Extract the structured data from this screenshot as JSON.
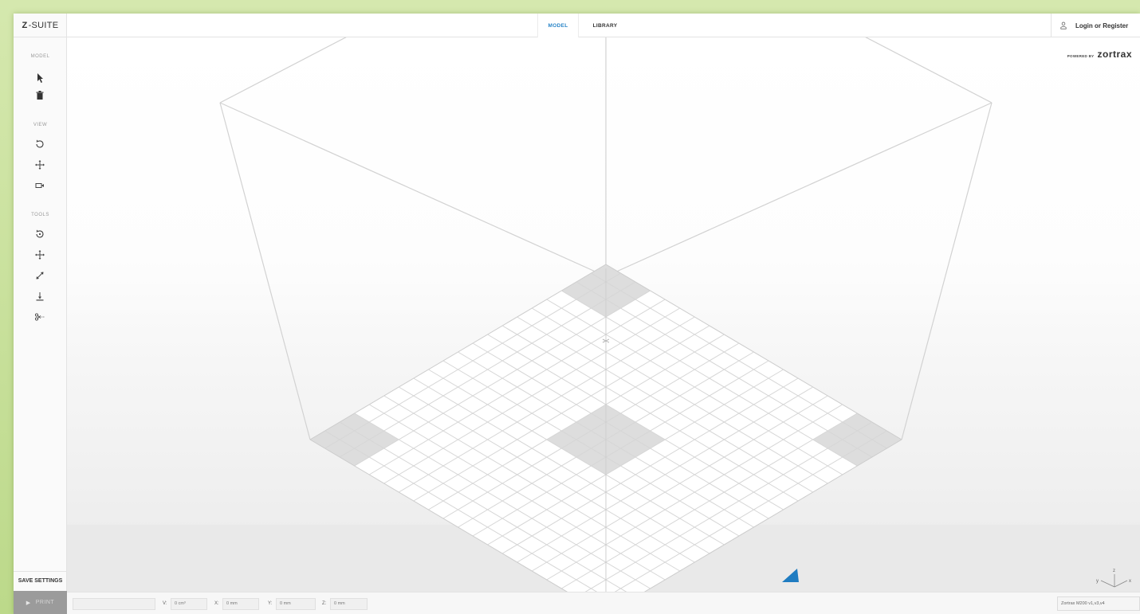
{
  "app": {
    "logo_bold": "Z",
    "logo_rest": "-SUITE"
  },
  "sidebar": {
    "sections": {
      "model": "MODEL",
      "view": "VIEW",
      "tools": "TOOLS"
    },
    "model_tools": [
      "select-icon",
      "trash-icon"
    ],
    "view_tools": [
      "rotate-view-icon",
      "pan-view-icon",
      "camera-icon"
    ],
    "tools": [
      "rotate-model-icon",
      "move-model-icon",
      "scale-icon",
      "lay-flat-icon",
      "cut-icon"
    ],
    "save_settings": "SAVE SETTINGS",
    "print": "PRINT"
  },
  "tabs": {
    "model": "MODEL",
    "library": "LIBRARY",
    "active": "MODEL"
  },
  "account": {
    "login_label": "Login or Register"
  },
  "branding": {
    "powered_by": "POWERED BY",
    "brand": "zortrax"
  },
  "bottom": {
    "v_label": "V:",
    "v_value": "0 cm³",
    "x_label": "X:",
    "x_value": "0 mm",
    "y_label": "Y:",
    "y_value": "0 mm",
    "z_label": "Z:",
    "z_value": "0 mm",
    "printer": "Zortrax M200 v1,v3,v4"
  },
  "axes": {
    "x": "x",
    "y": "y",
    "z": "z"
  },
  "colors": {
    "accent": "#2a86c8",
    "background_frame": "#c9dfa0",
    "print_button": "#9b9b9b"
  }
}
